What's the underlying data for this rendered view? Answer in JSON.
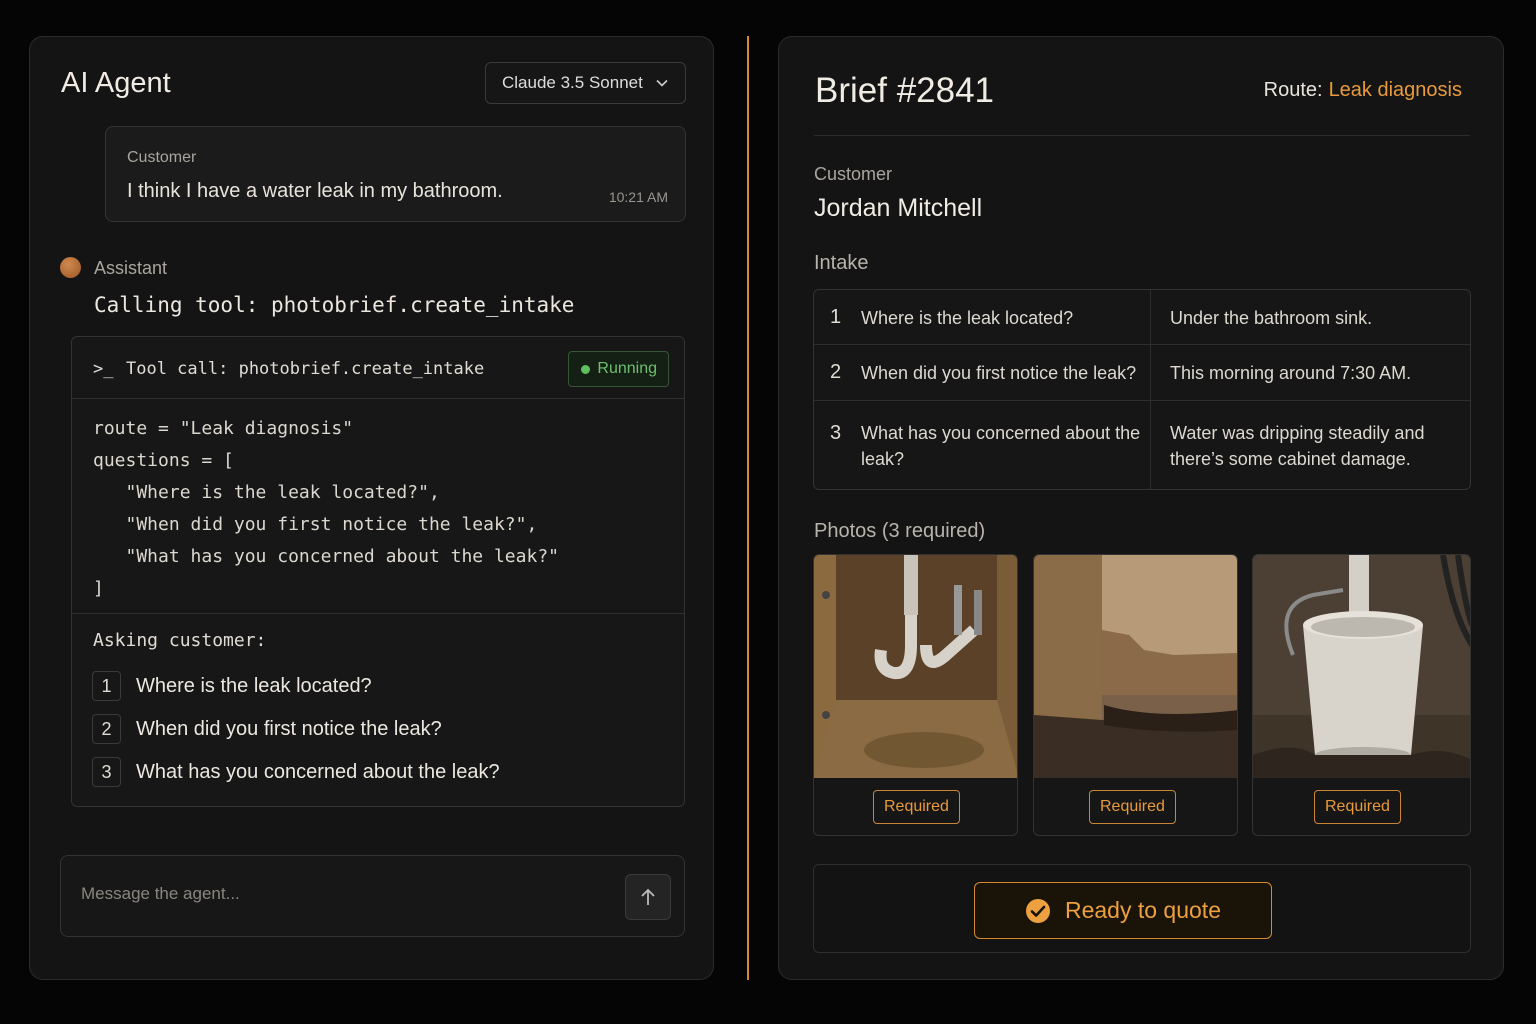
{
  "agent": {
    "title": "AI Agent",
    "model": "Claude 3.5 Sonnet",
    "customer_message": {
      "role": "Customer",
      "text": "I think I have a water leak in my bathroom.",
      "time": "10:21 AM"
    },
    "assistant": {
      "role": "Assistant",
      "calling": "Calling tool: photobrief.create_intake"
    },
    "tool_call": {
      "prompt_glyph": ">_",
      "label": "Tool call: photobrief.create_intake",
      "status": "Running",
      "status_color": "#5fbf5f",
      "code_lines": [
        "route = \"Leak diagnosis\"",
        "questions = [",
        "   \"Where is the leak located?\",",
        "   \"When did you first notice the leak?\",",
        "   \"What has you concerned about the leak?\"",
        "]"
      ],
      "asking_label": "Asking customer:",
      "questions": [
        {
          "num": "1",
          "text": "Where is the leak located?"
        },
        {
          "num": "2",
          "text": "When did you first notice the leak?"
        },
        {
          "num": "3",
          "text": "What has you concerned about the leak?"
        }
      ]
    },
    "input_placeholder": "Message the agent..."
  },
  "brief": {
    "title": "Brief #2841",
    "route_label": "Route:",
    "route_value": "Leak diagnosis",
    "customer_label": "Customer",
    "customer_name": "Jordan Mitchell",
    "intake_label": "Intake",
    "intake": [
      {
        "num": "1",
        "question": "Where is the leak located?",
        "answer": "Under the bathroom sink."
      },
      {
        "num": "2",
        "question": "When did you first notice the leak?",
        "answer": "This morning around 7:30 AM."
      },
      {
        "num": "3",
        "question": "What has you concerned about the leak?",
        "answer": "Water was dripping steadily and there’s some cabinet damage."
      }
    ],
    "photos_label": "Photos (3 required)",
    "photos": [
      {
        "name": "under-sink-pipes-photo",
        "badge": "Required"
      },
      {
        "name": "cabinet-damage-photo",
        "badge": "Required"
      },
      {
        "name": "bucket-under-pipe-photo",
        "badge": "Required"
      }
    ],
    "ready_label": "Ready to quote",
    "accent_color": "#e89a3c"
  }
}
